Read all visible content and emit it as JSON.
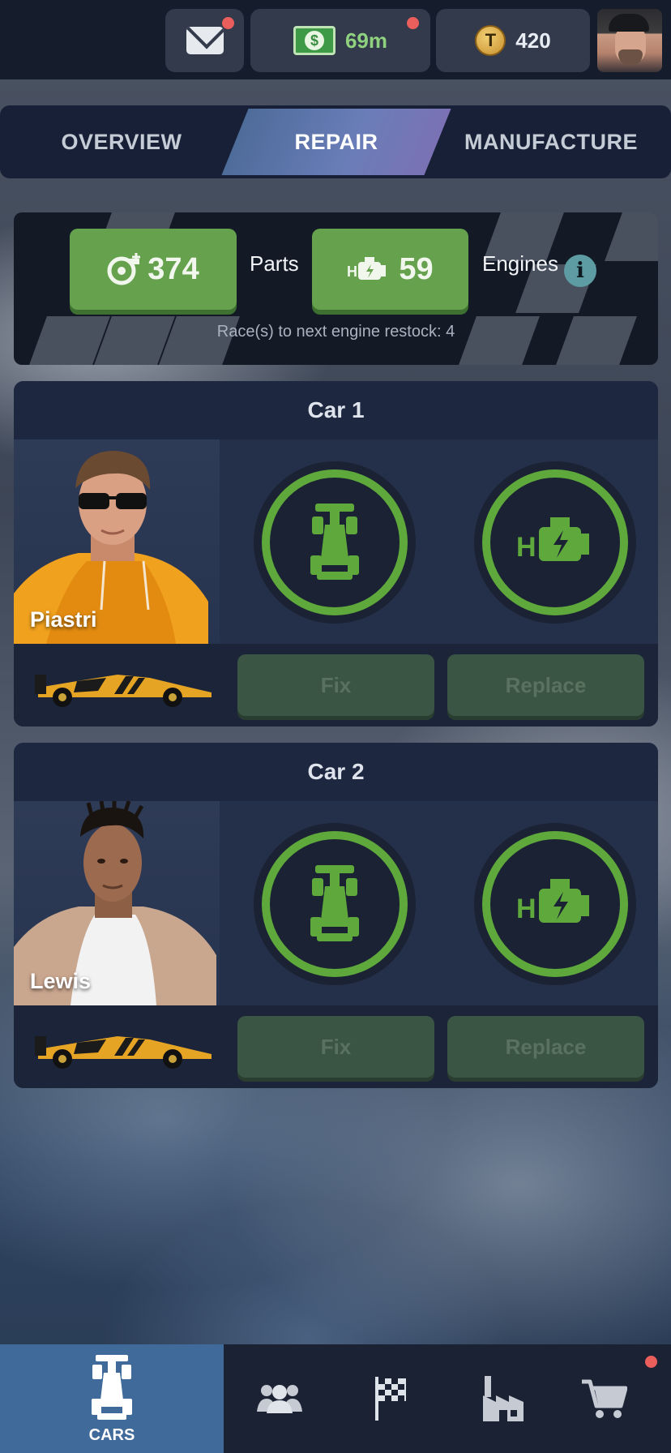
{
  "topbar": {
    "mail": {
      "icon": "mail-icon",
      "has_notification": true
    },
    "cash": {
      "icon": "cash-icon",
      "value": "69m",
      "has_notification": true
    },
    "coins": {
      "icon": "coin-icon",
      "value": "420"
    },
    "avatar": {
      "icon": "profile-avatar"
    }
  },
  "tabs": [
    {
      "label": "OVERVIEW",
      "active": false
    },
    {
      "label": "REPAIR",
      "active": true
    },
    {
      "label": "MANUFACTURE",
      "active": false
    }
  ],
  "resources": {
    "parts": {
      "icon": "turbo-part-icon",
      "value": "374",
      "label": "Parts"
    },
    "engines": {
      "icon": "engine-icon",
      "value": "59",
      "label": "Engines"
    },
    "info_icon": "info-icon",
    "restock_text": "Race(s) to next engine restock: 4"
  },
  "cars": [
    {
      "title": "Car 1",
      "driver": "Piastri",
      "chassis_icon": "car-chassis-icon",
      "engine_icon": "engine-icon",
      "fix_label": "Fix",
      "replace_label": "Replace"
    },
    {
      "title": "Car 2",
      "driver": "Lewis",
      "chassis_icon": "car-chassis-icon",
      "engine_icon": "engine-icon",
      "fix_label": "Fix",
      "replace_label": "Replace"
    }
  ],
  "bottom_nav": [
    {
      "icon": "car-icon",
      "label": "CARS",
      "active": true
    },
    {
      "icon": "team-icon",
      "label": "",
      "active": false
    },
    {
      "icon": "race-flag-icon",
      "label": "",
      "active": false
    },
    {
      "icon": "factory-icon",
      "label": "",
      "active": false
    },
    {
      "icon": "cart-icon",
      "label": "",
      "active": false,
      "has_notification": true
    }
  ],
  "colors": {
    "accent_green": "#5fa83b",
    "resource_green": "#66a24e",
    "tab_active": "#6a7db8",
    "nav_active": "#3f6a99",
    "notification": "#ea5f5c"
  }
}
